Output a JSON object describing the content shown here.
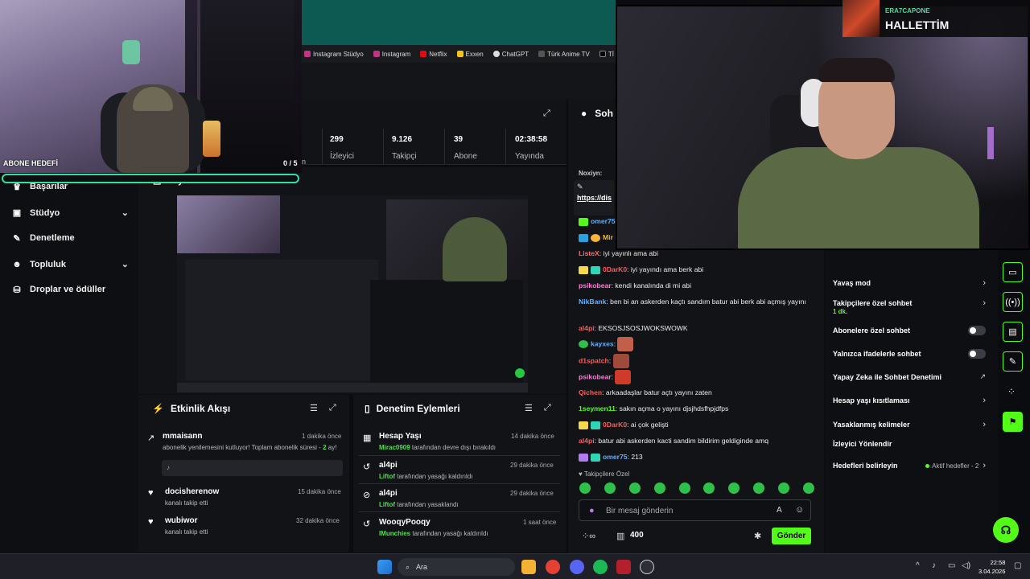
{
  "bookmarks": [
    "Instagram Stüdyo",
    "Instagram",
    "Netflix",
    "Exxen",
    "ChatGPT",
    "Türk Anime TV",
    "Tİ"
  ],
  "webcam_overlay": {
    "goal_label": "ABONE HEDEFİ",
    "goal_count": "0 / 5"
  },
  "alert": {
    "username": "ERA7CAPONE",
    "message": "HALLETTİM"
  },
  "sidebar": {
    "items": [
      {
        "label": "Başarılar",
        "icon": "trophy-icon",
        "chevron": false
      },
      {
        "label": "Stüdyo",
        "icon": "studio-icon",
        "chevron": true
      },
      {
        "label": "Denetleme",
        "icon": "wrench-icon",
        "chevron": false
      },
      {
        "label": "Topluluk",
        "icon": "community-icon",
        "chevron": true
      },
      {
        "label": "Droplar ve ödüller",
        "icon": "drops-icon",
        "chevron": false
      }
    ]
  },
  "stats": {
    "partial_label": "yın",
    "items": [
      {
        "value": "299",
        "label": "İzleyici"
      },
      {
        "value": "9.126",
        "label": "Takipçi"
      },
      {
        "value": "39",
        "label": "Abone"
      },
      {
        "value": "02:38:58",
        "label": "Yayında"
      }
    ]
  },
  "preview": {
    "title": "Yayın Ön İzlemesi"
  },
  "activity": {
    "title": "Etkinlik Akışı",
    "items": [
      {
        "name": "mmaisann",
        "time": "1 dakika önce",
        "text": "abonelik yenilemesini kutluyor! Toplam abonelik süresi - ",
        "highlight": "2",
        "text2": " ay!"
      },
      {
        "name": "docisherenow",
        "time": "15 dakika önce",
        "text": "kanalı takip etti"
      },
      {
        "name": "wubiwor",
        "time": "32 dakika önce",
        "text": "kanalı takip etti"
      }
    ]
  },
  "moderation": {
    "title": "Denetim Eylemleri",
    "items": [
      {
        "name": "Hesap Yaşı",
        "time": "14 dakika önce",
        "actor": "Mirac0909",
        "text": " tarafından devre dışı bırakıldı"
      },
      {
        "name": "al4pi",
        "time": "29 dakika önce",
        "actor": "Liftof",
        "text": " tarafından yasağı kaldırıldı"
      },
      {
        "name": "al4pi",
        "time": "29 dakika önce",
        "actor": "Liftof",
        "text": " tarafından yasaklandı"
      },
      {
        "name": "WooqyPooqy",
        "time": "1 saat önce",
        "actor": "IMunchies",
        "text": " tarafından yasağı kaldırıldı"
      }
    ]
  },
  "chat": {
    "title": "Soh",
    "pinned_user": "Noxiyn:",
    "pinned_link": "https://dis",
    "lines": [
      {
        "user": "omer75",
        "color": "#5fb0ff",
        "text": ""
      },
      {
        "user": "Mir",
        "color": "#f5b63b",
        "text": ""
      },
      {
        "user": "ListeX",
        "color": "#ff6b6b",
        "text": ": iyi yayınlı ama abi"
      },
      {
        "user": "0DarK0",
        "color": "#ff5a5a",
        "text": ": iyi yayındı ama berk abi"
      },
      {
        "user": "psikobear",
        "color": "#ff7ad9",
        "text": ": kendi kanalında di mi abi"
      },
      {
        "user": "NikBank",
        "color": "#5fb0ff",
        "text": ": ben bi an askerden kaçtı sandım batur abi berk abi açmış yayını"
      },
      {
        "user": "al4pi",
        "color": "#ff5a5a",
        "text": ": EKSOSJSOSJWOKSWOWK"
      },
      {
        "user": "kayxes",
        "color": "#5fb0ff",
        "text": ":"
      },
      {
        "user": "d1spatch",
        "color": "#ff5a5a",
        "text": ":"
      },
      {
        "user": "psikobear",
        "color": "#ff7ad9",
        "text": ":"
      },
      {
        "user": "Qichen",
        "color": "#ff5a5a",
        "text": ": arkaadaşlar batur açtı yayını zaten"
      },
      {
        "user": "1seymen11",
        "color": "#53fc18",
        "text": ": sakın açma o yayını djsjhdsfhpjdfps"
      },
      {
        "user": "0DarK0",
        "color": "#ff5a5a",
        "text": ": ai çok gelişti"
      },
      {
        "user": "al4pi",
        "color": "#ff5a5a",
        "text": ": batur abi askerden kacti sandim bildirim geldiginde amq"
      },
      {
        "user": "omer75",
        "color": "#5fb0ff",
        "text": ": 213"
      }
    ],
    "follow_only": "Takipçilere Özel",
    "input_placeholder": "Bir mesaj gönderin",
    "points": "400",
    "send_label": "Gönder"
  },
  "settings": {
    "items": [
      {
        "label": "Yavaş mod",
        "control": "chevron"
      },
      {
        "label": "Takipçilere özel sohbet",
        "control": "chevron",
        "sub": "1 dk."
      },
      {
        "label": "Abonelere özel sohbet",
        "control": "toggle"
      },
      {
        "label": "Yalnızca ifadelerle sohbet",
        "control": "toggle"
      },
      {
        "label": "Yapay Zeka ile Sohbet Denetimi",
        "control": "external"
      },
      {
        "label": "Hesap yaşı kısıtlaması",
        "control": "chevron"
      },
      {
        "label": "Yasaklanmış kelimeler",
        "control": "chevron"
      },
      {
        "label": "İzleyici Yönlendir",
        "control": "none"
      },
      {
        "label": "Hedefleri belirleyin",
        "control": "chevron",
        "extra": "Aktif hedefler - 2"
      }
    ]
  },
  "taskbar": {
    "search_label": "Ara",
    "time": "22:58",
    "date": "3.04.2026"
  },
  "colors": {
    "accent": "#53fc18",
    "panel": "#121317",
    "background": "#0b0c0f"
  }
}
